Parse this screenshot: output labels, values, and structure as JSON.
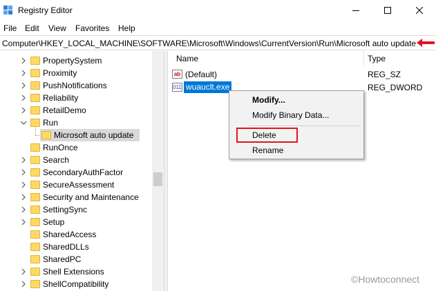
{
  "window": {
    "title": "Registry Editor"
  },
  "menu": [
    "File",
    "Edit",
    "View",
    "Favorites",
    "Help"
  ],
  "address": "Computer\\HKEY_LOCAL_MACHINE\\SOFTWARE\\Microsoft\\Windows\\CurrentVersion\\Run\\Microsoft auto update",
  "tree": [
    {
      "label": "PropertySystem",
      "expand": "right"
    },
    {
      "label": "Proximity",
      "expand": "right"
    },
    {
      "label": "PushNotifications",
      "expand": "right"
    },
    {
      "label": "Reliability",
      "expand": "right"
    },
    {
      "label": "RetailDemo",
      "expand": "right"
    },
    {
      "label": "Run",
      "expand": "down"
    },
    {
      "label": "Microsoft auto update",
      "expand": "none"
    },
    {
      "label": "RunOnce",
      "expand": "none"
    },
    {
      "label": "Search",
      "expand": "right"
    },
    {
      "label": "SecondaryAuthFactor",
      "expand": "right"
    },
    {
      "label": "SecureAssessment",
      "expand": "right"
    },
    {
      "label": "Security and Maintenance",
      "expand": "right"
    },
    {
      "label": "SettingSync",
      "expand": "right"
    },
    {
      "label": "Setup",
      "expand": "right"
    },
    {
      "label": "SharedAccess",
      "expand": "none"
    },
    {
      "label": "SharedDLLs",
      "expand": "none"
    },
    {
      "label": "SharedPC",
      "expand": "none"
    },
    {
      "label": "Shell Extensions",
      "expand": "right"
    },
    {
      "label": "ShellCompatibility",
      "expand": "right"
    }
  ],
  "columns": {
    "name": "Name",
    "type": "Type"
  },
  "values": [
    {
      "icon": "ab",
      "name": "(Default)",
      "type": "REG_SZ"
    },
    {
      "icon": "011",
      "name": "wuauclt.exe",
      "type": "REG_DWORD"
    }
  ],
  "context_menu": {
    "modify": "Modify...",
    "modify_binary": "Modify Binary Data...",
    "delete": "Delete",
    "rename": "Rename"
  },
  "watermark": "©Howtoconnect",
  "colors": {
    "selection": "#0078d7",
    "highlight_box": "#e0141e",
    "arrow": "#e0141e"
  }
}
